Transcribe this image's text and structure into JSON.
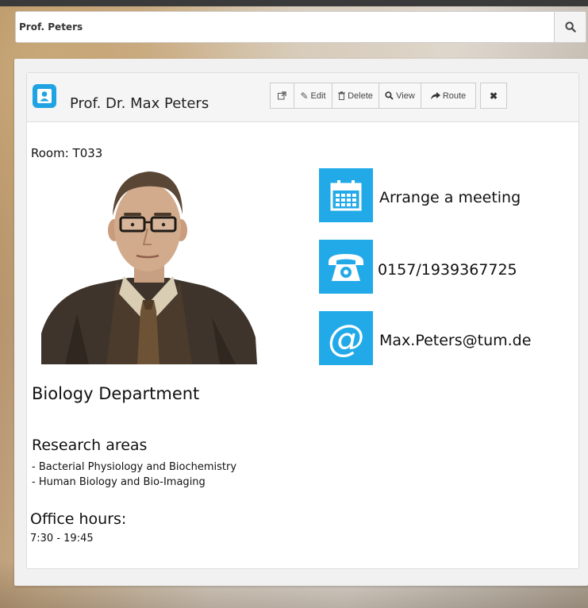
{
  "search": {
    "value": "Prof. Peters",
    "icon": "search-icon"
  },
  "card": {
    "title": "Prof. Dr. Max Peters",
    "title_icon": "contact-card-icon",
    "toolbar": {
      "open_icon": "external-link-icon",
      "edit_label": "Edit",
      "delete_label": "Delete",
      "view_label": "View",
      "route_label": "Route",
      "close_icon": "close-icon"
    },
    "room": "Room: T033",
    "photo": "portrait-photo",
    "contacts": {
      "meeting": {
        "label": "Arrange a meeting",
        "icon": "calendar-icon"
      },
      "phone": {
        "label": "0157/1939367725",
        "icon": "phone-icon"
      },
      "email": {
        "label": "Max.Peters@tum.de",
        "icon": "at-sign-icon"
      }
    },
    "department": "Biology Department",
    "research": {
      "title": "Research areas",
      "items": [
        "-  Bacterial Physiology and Biochemistry",
        "-  Human Biology and Bio-Imaging"
      ]
    },
    "office_hours": {
      "title": "Office hours:",
      "value": "7:30 - 19:45"
    }
  },
  "colors": {
    "accent": "#22aae8",
    "panel_header": "#f5f5f5"
  }
}
